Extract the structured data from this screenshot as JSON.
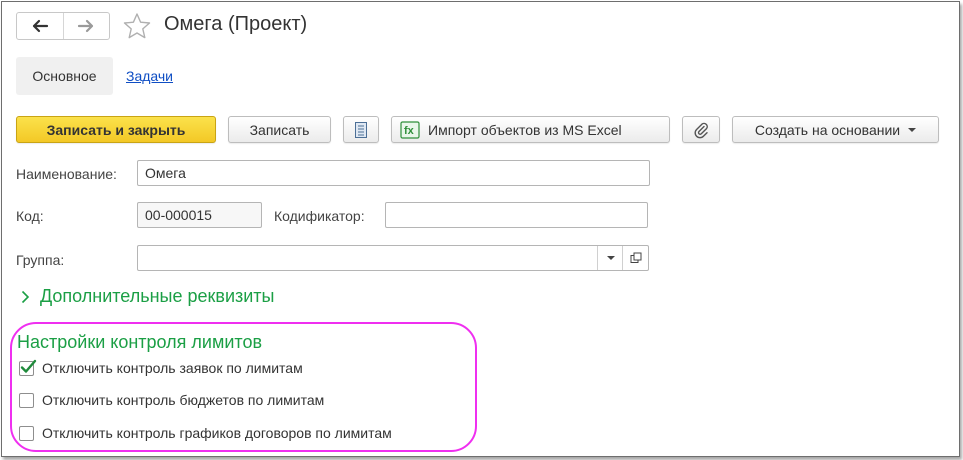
{
  "window": {
    "title": "Омега (Проект)"
  },
  "tabs": [
    {
      "label": "Основное",
      "active": true
    },
    {
      "label": "Задачи",
      "active": false
    }
  ],
  "toolbar": {
    "save_close_label": "Записать и закрыть",
    "save_label": "Записать",
    "import_label": "Импорт объектов из MS Excel",
    "create_based_label": "Создать на основании"
  },
  "form": {
    "name_label": "Наименование:",
    "name_value": "Омега",
    "code_label": "Код:",
    "code_value": "00-000015",
    "codifier_label": "Кодификатор:",
    "codifier_value": "",
    "group_label": "Группа:",
    "group_value": ""
  },
  "additional": {
    "label": "Дополнительные реквизиты"
  },
  "limits": {
    "title": "Настройки контроля лимитов",
    "items": [
      {
        "label": "Отключить контроль заявок по лимитам",
        "checked": true
      },
      {
        "label": "Отключить контроль бюджетов по лимитам",
        "checked": false
      },
      {
        "label": "Отключить контроль графиков договоров по лимитам",
        "checked": false
      }
    ]
  },
  "colors": {
    "accent_green": "#1b9f45",
    "primary_button": "#f3c826",
    "link": "#0f4ec4",
    "highlight_outline": "#ef2ff0"
  },
  "icons": {
    "back": "arrow-left-icon",
    "forward": "arrow-right-icon",
    "favorite": "star-icon",
    "list": "list-icon",
    "excel": "excel-icon",
    "attach": "paperclip-icon",
    "dropdown": "chevron-down-icon",
    "open": "open-form-icon",
    "expand": "chevron-right-icon",
    "check": "checkmark-icon"
  }
}
